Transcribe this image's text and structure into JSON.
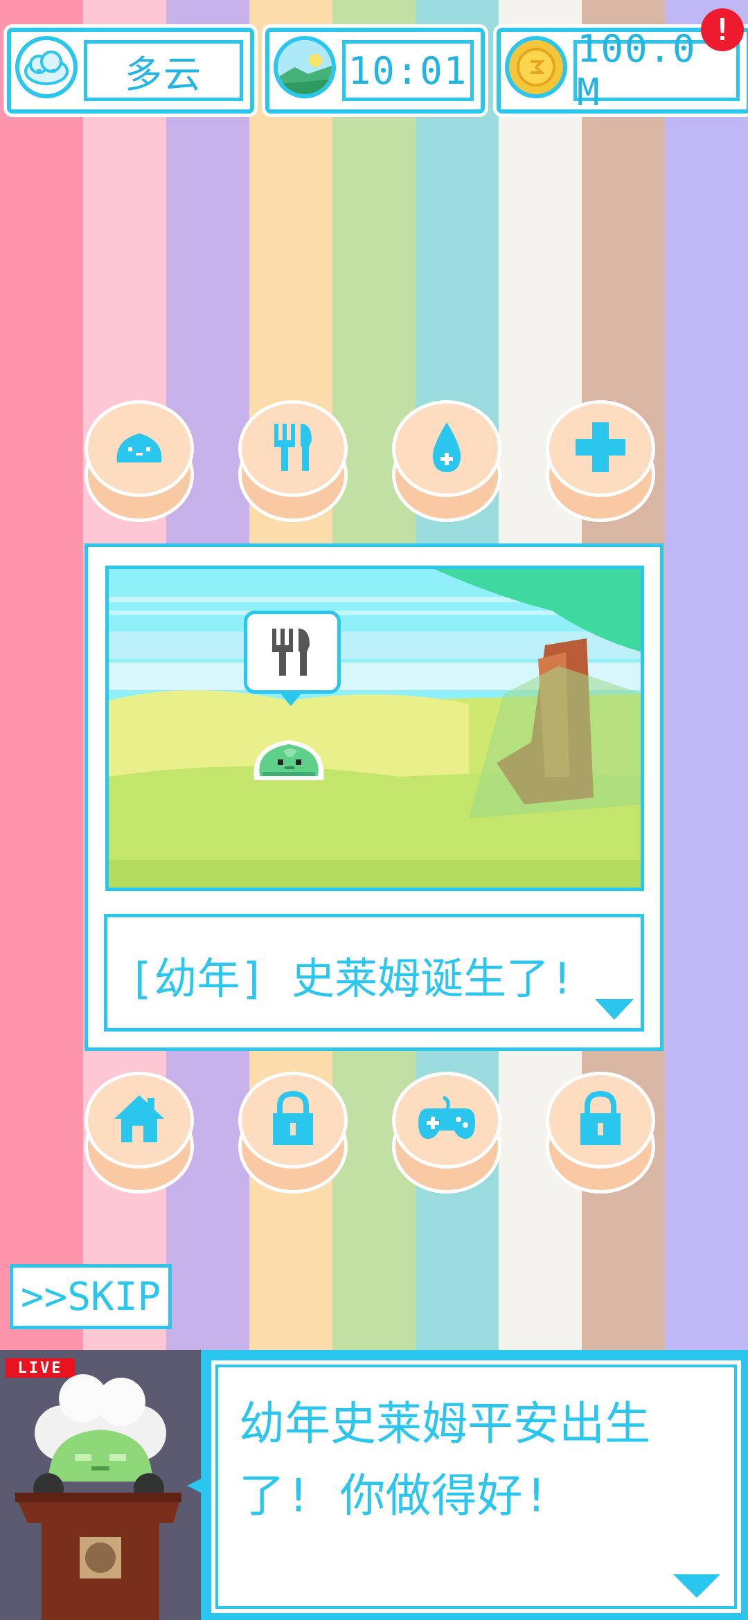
{
  "status_bar": {
    "weather": "多云",
    "time": "10:01",
    "money": "100.0 M",
    "alert_symbol": "!"
  },
  "action_buttons_top": [
    {
      "icon": "slime-icon"
    },
    {
      "icon": "fork-knife-icon"
    },
    {
      "icon": "water-drop-icon"
    },
    {
      "icon": "plus-icon"
    }
  ],
  "scene": {
    "speech_bubble_icon": "fork-knife-icon",
    "message": "[幼年] 史莱姆诞生了!"
  },
  "action_buttons_bottom": [
    {
      "icon": "home-icon"
    },
    {
      "icon": "lock-icon"
    },
    {
      "icon": "gamepad-icon"
    },
    {
      "icon": "lock-icon"
    }
  ],
  "skip_label": ">>SKIP",
  "broadcast": {
    "live_label": "LIVE",
    "text": "幼年史莱姆平安出生了!  你做得好!"
  },
  "colors": {
    "accent": "#2ac6ee",
    "stripes": [
      "#ff95ac",
      "#fdc7d3",
      "#c7b1ea",
      "#fcdcaa",
      "#c2e0a4",
      "#9adbde",
      "#f5f3ee",
      "#d9b5a4",
      "#c0b7f7"
    ]
  }
}
